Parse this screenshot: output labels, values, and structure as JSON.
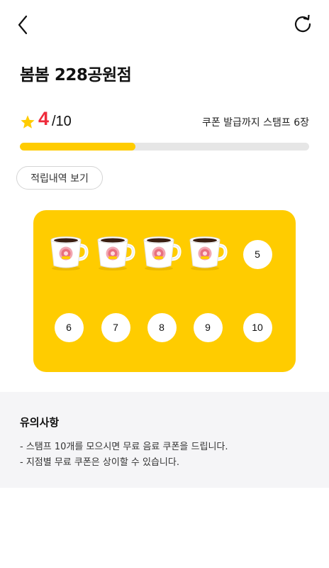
{
  "header": {
    "back_icon": "chevron-left-icon",
    "refresh_icon": "refresh-icon"
  },
  "store": {
    "name": "봄봄 228공원점"
  },
  "stamps": {
    "current": "4",
    "total": "/10",
    "remaining_text": "쿠폰 발급까지 스탬프 6장",
    "progress": 0.4,
    "accent_color": "#ffcc00",
    "count_color": "#ee2b3b"
  },
  "history_button": {
    "label": "적립내역 보기"
  },
  "stamp_card": {
    "slots": [
      {
        "filled": true,
        "label": ""
      },
      {
        "filled": true,
        "label": ""
      },
      {
        "filled": true,
        "label": ""
      },
      {
        "filled": true,
        "label": ""
      },
      {
        "filled": false,
        "label": "5"
      },
      {
        "filled": false,
        "label": "6"
      },
      {
        "filled": false,
        "label": "7"
      },
      {
        "filled": false,
        "label": "8"
      },
      {
        "filled": false,
        "label": "9"
      },
      {
        "filled": false,
        "label": "10"
      }
    ],
    "filled_icon": "coffee-cup-icon"
  },
  "notice": {
    "title": "유의사항",
    "lines": [
      "- 스탬프 10개를 모으시면 무료 음료 쿠폰을 드립니다.",
      "- 지점별 무료 쿠폰은 상이할 수 있습니다."
    ]
  }
}
